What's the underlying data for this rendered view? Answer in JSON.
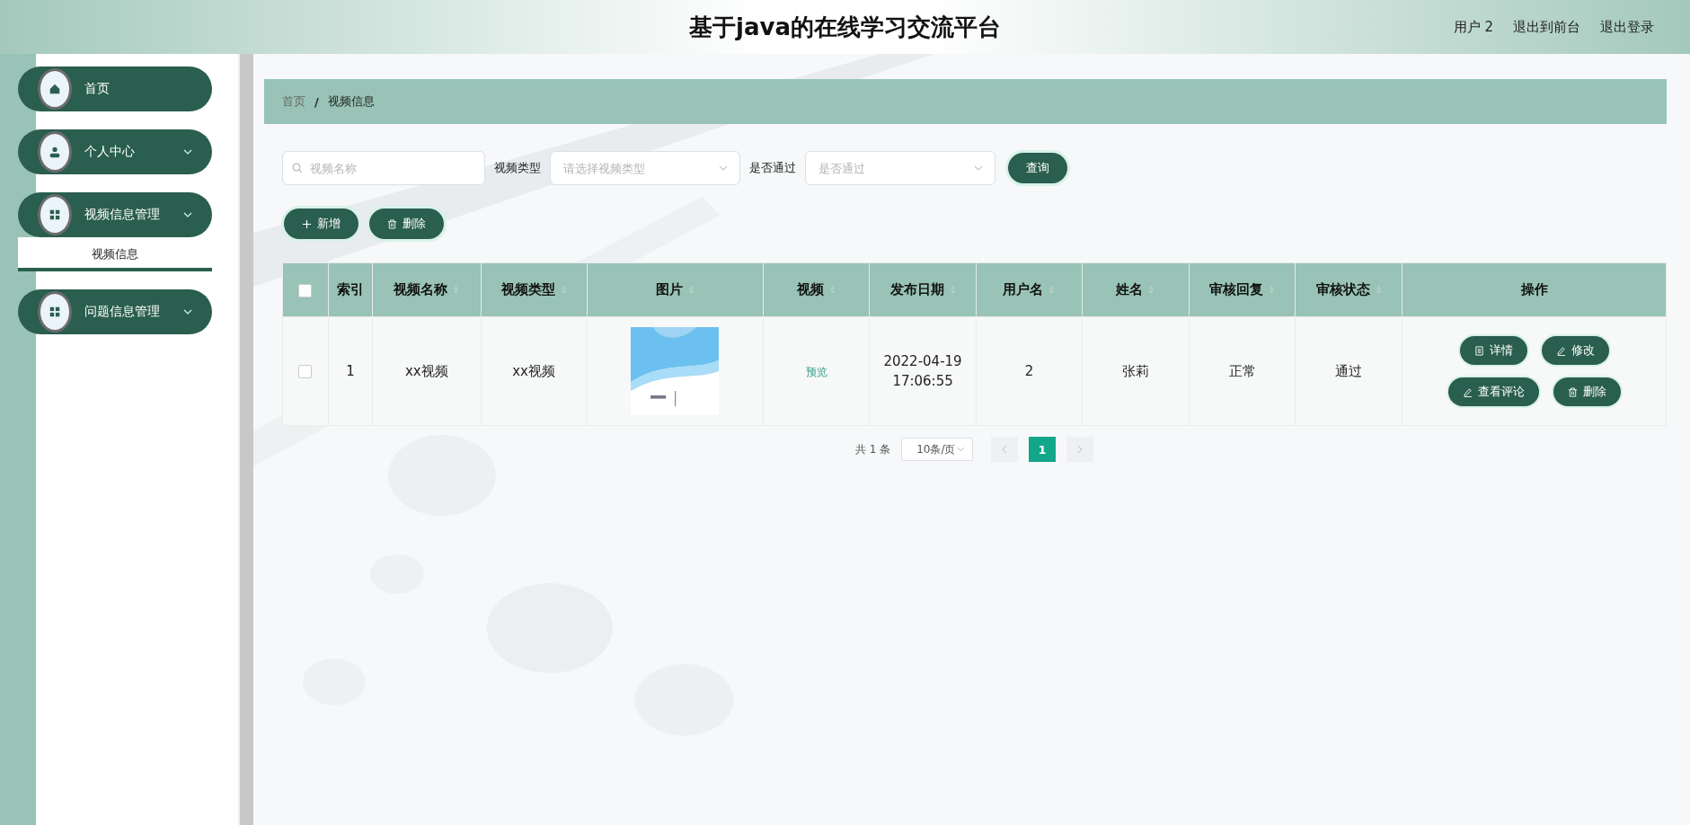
{
  "header": {
    "title": "基于java的在线学习交流平台",
    "links": [
      "用户 2",
      "退出到前台",
      "退出登录"
    ]
  },
  "sidebar": {
    "items": [
      {
        "kind": "link",
        "label": "首页"
      },
      {
        "kind": "submenu",
        "label": "个人中心"
      },
      {
        "kind": "submenu",
        "label": "视频信息管理",
        "children": [
          {
            "label": "视频信息",
            "selected": true
          }
        ]
      },
      {
        "kind": "submenu",
        "label": "问题信息管理"
      }
    ]
  },
  "breadcrumb": [
    "首页",
    "/",
    "视频信息"
  ],
  "filters": {
    "search": {
      "placeholder": "视频名称"
    },
    "selects": [
      {
        "label": "视频类型",
        "placeholder": "请选择视频类型"
      },
      {
        "label": "是否通过",
        "placeholder": "是否通过"
      }
    ],
    "query_button": "查询"
  },
  "actions": [
    {
      "label": "新增"
    },
    {
      "label": "删除"
    }
  ],
  "table": {
    "header_checked": false,
    "columns": [
      {
        "label": "索引",
        "sortable": false
      },
      {
        "label": "视频名称",
        "sortable": true
      },
      {
        "label": "视频类型",
        "sortable": true
      },
      {
        "label": "图片",
        "sortable": true
      },
      {
        "label": "视频",
        "sortable": true
      },
      {
        "label": "发布日期",
        "sortable": true
      },
      {
        "label": "用户名",
        "sortable": true
      },
      {
        "label": "姓名",
        "sortable": true
      },
      {
        "label": "审核回复",
        "sortable": true
      },
      {
        "label": "审核状态",
        "sortable": true
      },
      {
        "label": "操作",
        "sortable": false
      }
    ],
    "rows": [
      {
        "checked": false,
        "cells": [
          {
            "kind": "text",
            "text": "1"
          },
          {
            "kind": "text",
            "text": "xx视频"
          },
          {
            "kind": "text",
            "text": "xx视频"
          },
          {
            "kind": "picture"
          },
          {
            "kind": "link",
            "text": "预览"
          },
          {
            "kind": "text",
            "text": "2022-04-19 17:06:55"
          },
          {
            "kind": "text",
            "text": "2"
          },
          {
            "kind": "text",
            "text": "张莉"
          },
          {
            "kind": "text",
            "text": "正常"
          },
          {
            "kind": "text",
            "text": "通过"
          },
          {
            "kind": "actions",
            "buttons": [
              {
                "label": "详情"
              },
              {
                "label": "修改"
              },
              {
                "label": "查看评论"
              },
              {
                "label": "删除"
              }
            ]
          }
        ]
      }
    ]
  },
  "pagination": {
    "total": "共 1 条",
    "page_size": "10条/页",
    "pages": [
      {
        "label": "1",
        "selected": true
      }
    ]
  }
}
